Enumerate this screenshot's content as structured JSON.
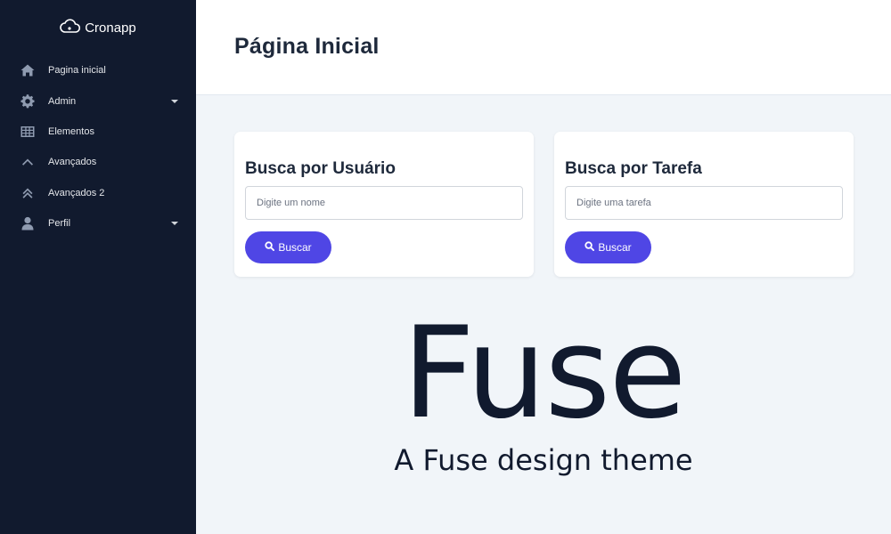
{
  "app": {
    "logo_text": "Cronapp",
    "logo_icon": "cloud-icon"
  },
  "sidebar": {
    "items": [
      {
        "label": "Pagina inicial",
        "icon": "home-icon",
        "has_submenu": false
      },
      {
        "label": "Admin",
        "icon": "gear-icon",
        "has_submenu": true
      },
      {
        "label": "Elementos",
        "icon": "table-icon",
        "has_submenu": false
      },
      {
        "label": "Avançados",
        "icon": "chevron-up-icon",
        "has_submenu": false
      },
      {
        "label": "Avançados 2",
        "icon": "double-chevron-up-icon",
        "has_submenu": false
      },
      {
        "label": "Perfil",
        "icon": "user-icon",
        "has_submenu": true
      }
    ]
  },
  "header": {
    "title": "Página Inicial"
  },
  "cards": [
    {
      "title": "Busca por Usuário",
      "placeholder": "Digite um nome",
      "button_label": "Buscar"
    },
    {
      "title": "Busca por Tarefa",
      "placeholder": "Digite uma tarefa",
      "button_label": "Buscar"
    }
  ],
  "branding": {
    "title": "Fuse",
    "subtitle": "A Fuse design theme"
  },
  "colors": {
    "sidebar_bg": "#111a2e",
    "content_bg": "#f1f5f9",
    "accent": "#4f46e5",
    "text_dark": "#1e293b"
  }
}
